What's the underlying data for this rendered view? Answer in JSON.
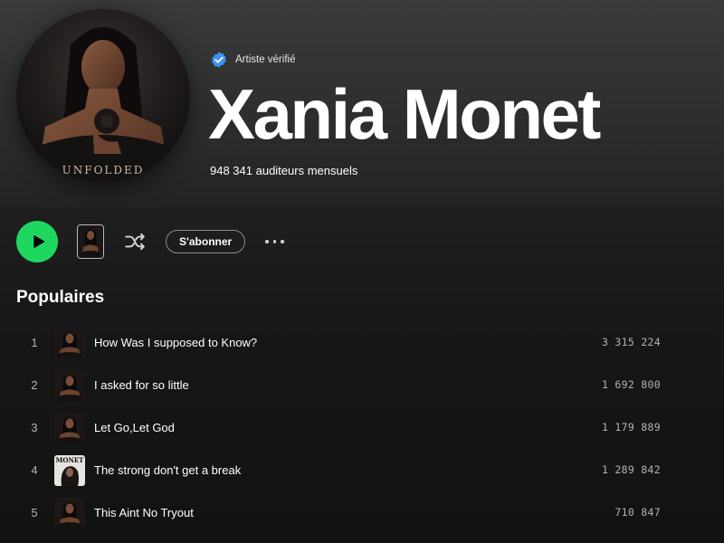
{
  "artist": {
    "verified_label": "Artiste vérifié",
    "name": "Xania Monet",
    "monthly_listeners": "948 341 auditeurs mensuels",
    "avatar_caption": "UNFOLDED"
  },
  "actions": {
    "play_icon": "play-icon",
    "shuffle_icon": "shuffle-icon",
    "follow_label": "S'abonner",
    "more_icon": "more-options-icon"
  },
  "colors": {
    "accent": "#1ed760",
    "verified": "#3d91f4",
    "background": "#121212",
    "muted_text": "#b3b3b3"
  },
  "popular": {
    "title": "Populaires",
    "tracks": [
      {
        "number": "1",
        "title": "How Was I supposed to Know?",
        "plays": "3 315 224",
        "art": "unfolded"
      },
      {
        "number": "2",
        "title": "I asked for so little",
        "plays": "1 692 800",
        "art": "unfolded"
      },
      {
        "number": "3",
        "title": "Let Go,Let God",
        "plays": "1 179 889",
        "art": "unfolded"
      },
      {
        "number": "4",
        "title": "The strong don't get a break",
        "plays": "1 289 842",
        "art": "monet",
        "art_caption": "MONET"
      },
      {
        "number": "5",
        "title": "This Aint No Tryout",
        "plays": "710 847",
        "art": "unfolded"
      }
    ]
  }
}
